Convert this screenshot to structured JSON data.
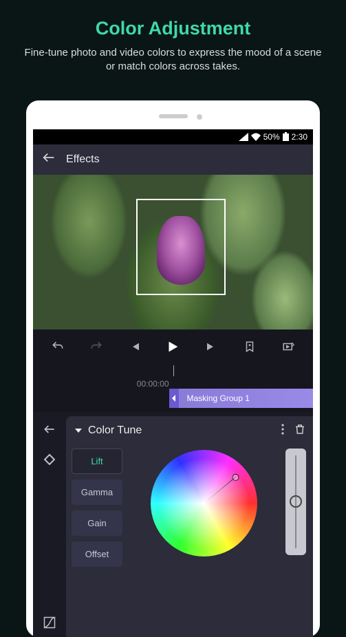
{
  "promo": {
    "title": "Color Adjustment",
    "subtitle": "Fine-tune photo and video colors to express the mood of a scene or match colors across takes."
  },
  "status_bar": {
    "battery_pct": "50%",
    "time": "2:30"
  },
  "header": {
    "title": "Effects"
  },
  "timeline": {
    "timecode": "00:00:00",
    "clip_label": "Masking Group 1"
  },
  "panel": {
    "title": "Color Tune",
    "tabs": [
      "Lift",
      "Gamma",
      "Gain",
      "Offset"
    ],
    "active_tab": "Lift"
  }
}
